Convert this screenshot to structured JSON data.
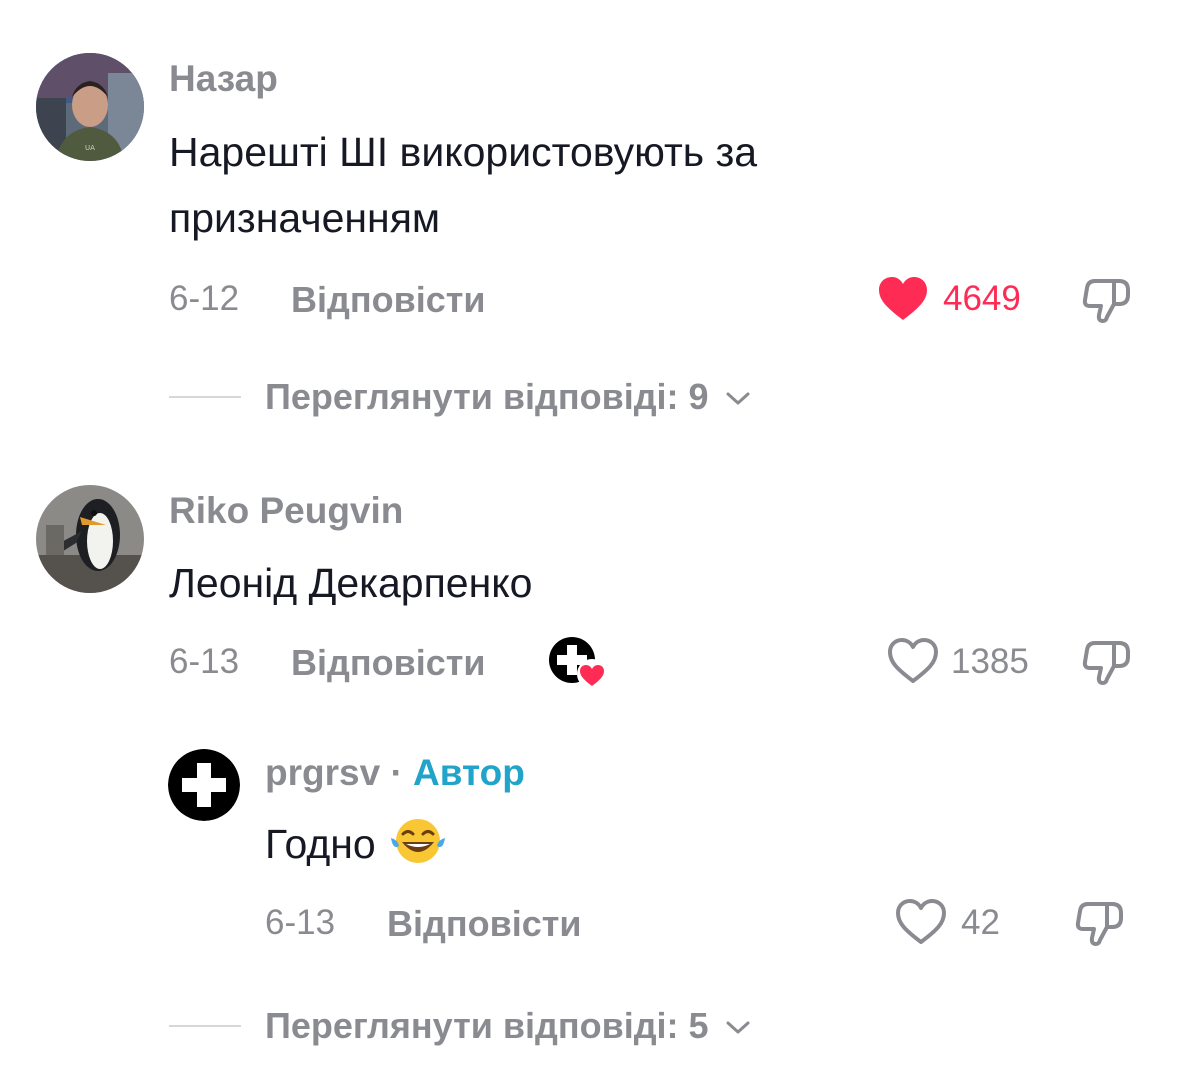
{
  "comments": [
    {
      "username": "Назар",
      "text_line1": "Нарешті ШІ використовують за",
      "text_line2": "призначенням",
      "date": "6-12",
      "reply_label": "Відповісти",
      "likes": "4649",
      "liked": true
    },
    {
      "username": "Riko Peugvin",
      "text": "Леонід Декарпенко",
      "date": "6-13",
      "reply_label": "Відповісти",
      "likes": "1385",
      "liked": false,
      "creator_liked": true
    }
  ],
  "reply": {
    "username": "prgrsv",
    "separator": "·",
    "author_label": "Автор",
    "text": "Годно",
    "emoji": "face-with-tears-of-joy",
    "date": "6-13",
    "reply_label": "Відповісти",
    "likes": "42",
    "liked": false
  },
  "view_replies": [
    {
      "label": "Переглянути відповіді: 9"
    },
    {
      "label": "Переглянути відповіді: 5"
    }
  ],
  "colors": {
    "liked": "#fe2c55",
    "author": "#20a4c9",
    "secondary_text": "#8a8b91",
    "primary_text": "#161823"
  }
}
